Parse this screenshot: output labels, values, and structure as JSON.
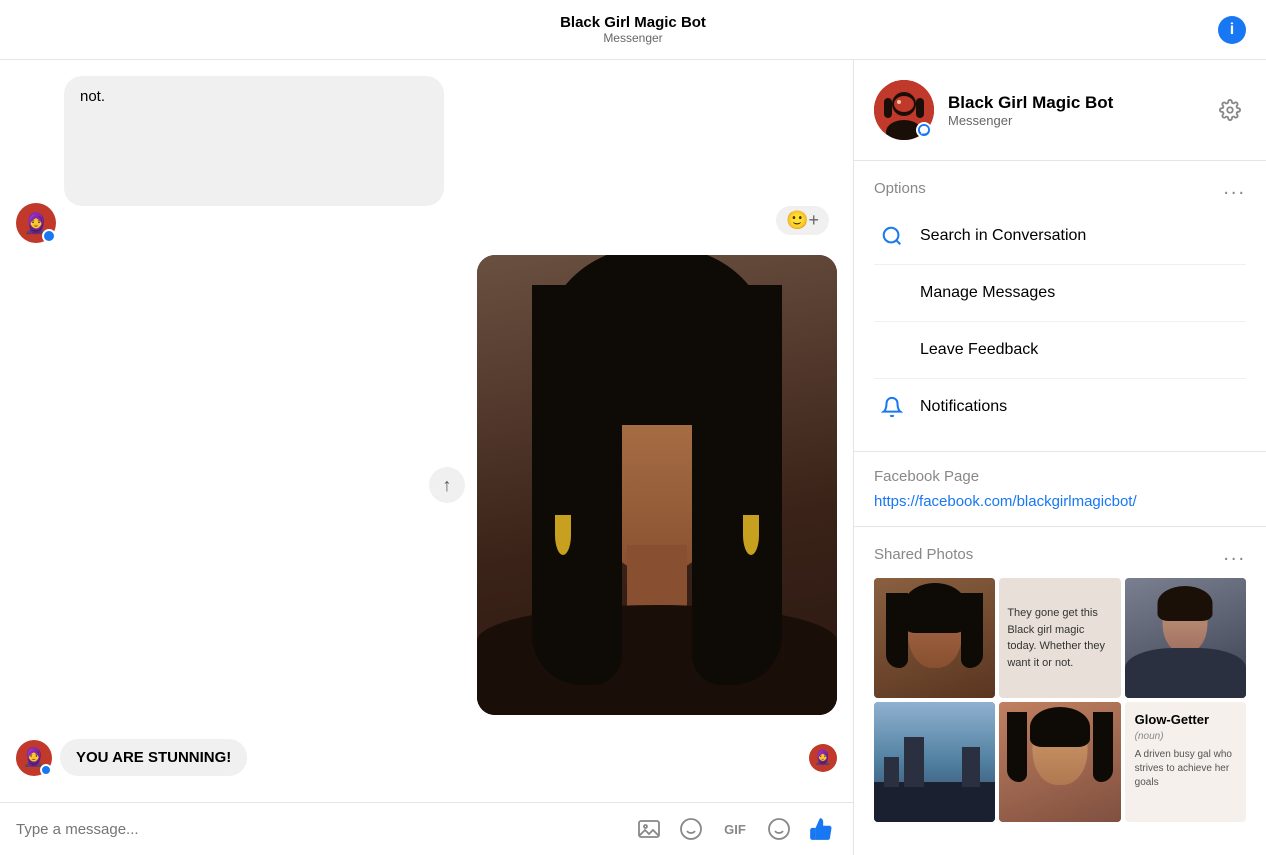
{
  "header": {
    "title": "Black Girl Magic Bot",
    "subtitle": "Messenger",
    "info_label": "i"
  },
  "chat": {
    "input_placeholder": "Type a message...",
    "partial_message_text": "not.",
    "stunning_message": "YOU ARE STUNNING!",
    "emoji_add": "🙂+",
    "share_icon": "↑",
    "actions": {
      "photo": "🖼",
      "emoji": "🙂",
      "gif": "GIF",
      "smiley": "☺",
      "like": "👍"
    }
  },
  "sidebar": {
    "bot_name": "Black Girl Magic Bot",
    "bot_platform": "Messenger",
    "options_title": "Options",
    "options_more": "...",
    "items": [
      {
        "id": "search",
        "label": "Search in Conversation",
        "icon": "🔍"
      },
      {
        "id": "manage",
        "label": "Manage Messages",
        "icon": ""
      },
      {
        "id": "feedback",
        "label": "Leave Feedback",
        "icon": ""
      },
      {
        "id": "notifications",
        "label": "Notifications",
        "icon": "🔔"
      }
    ],
    "facebook_page_title": "Facebook Page",
    "facebook_page_url": "https://facebook.com/blackgirlmagicbot/",
    "shared_photos_title": "Shared Photos",
    "shared_photos_more": "...",
    "photos": [
      {
        "id": 1,
        "type": "portrait",
        "bg": "linear-gradient(160deg, #8a6040, #5a3520)"
      },
      {
        "id": 2,
        "type": "text",
        "bg": "#e8e0d8",
        "text": "They gone get this Black girl magic today. Whether they want it or not."
      },
      {
        "id": 3,
        "type": "person",
        "bg": "linear-gradient(160deg, #7a8090, #3a4050)"
      },
      {
        "id": 4,
        "type": "cityscape",
        "bg": "linear-gradient(160deg, #7090b0, #304060)"
      },
      {
        "id": 5,
        "type": "portrait2",
        "bg": "linear-gradient(160deg, #c08060, #805040)"
      },
      {
        "id": 6,
        "type": "card",
        "bg": "#f5f0eb",
        "title": "Glow-Getter",
        "subtitle": "A driven busy gal who strives to achieve her goals"
      }
    ]
  }
}
